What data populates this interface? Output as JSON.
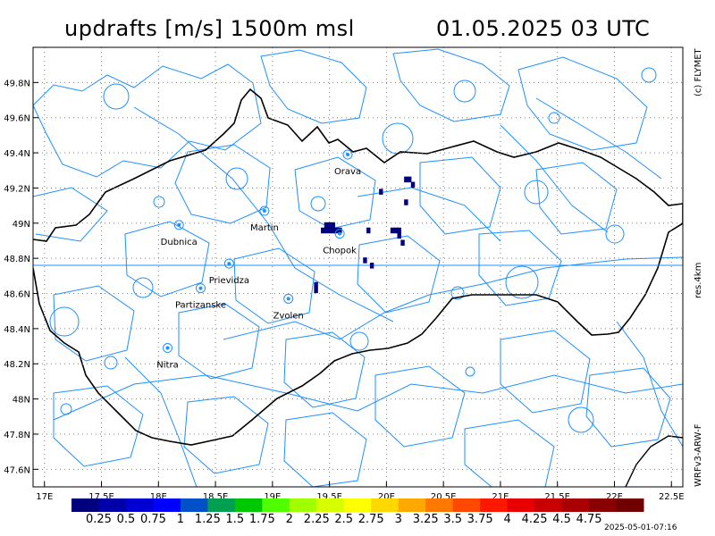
{
  "header": {
    "title_left": "updrafts [m/s] 1500m msl",
    "title_right": "01.05.2025   03 UTC"
  },
  "side_labels": {
    "copyright": "(c) FLYMET",
    "resolution": "res.4km",
    "model": "WRFv3-ARW-F"
  },
  "footer": {
    "timestamp": "2025-05-01-07:16"
  },
  "map": {
    "lat_labels": [
      "49.8N",
      "49.6N",
      "49.4N",
      "49.2N",
      "49N",
      "48.8N",
      "48.6N",
      "48.4N",
      "48.2N",
      "48N",
      "47.8N",
      "47.6N"
    ],
    "lat_values": [
      49.8,
      49.6,
      49.4,
      49.2,
      49.0,
      48.8,
      48.6,
      48.4,
      48.2,
      48.0,
      47.8,
      47.6
    ],
    "lon_labels": [
      "17E",
      "17.5E",
      "18E",
      "18.5E",
      "19E",
      "19.5E",
      "20E",
      "20.5E",
      "21E",
      "21.5E",
      "22E",
      "22.5E"
    ],
    "lon_values": [
      17.0,
      17.5,
      18.0,
      18.5,
      19.0,
      19.5,
      20.0,
      20.5,
      21.0,
      21.5,
      22.0,
      22.5
    ],
    "lon_range": [
      16.9,
      22.6
    ],
    "lat_range": [
      47.5,
      50.0
    ],
    "cities": [
      {
        "name": "Orava",
        "lon": 19.66,
        "lat": 49.39
      },
      {
        "name": "Martin",
        "lon": 18.93,
        "lat": 49.07
      },
      {
        "name": "Dubnica",
        "lon": 18.18,
        "lat": 48.99
      },
      {
        "name": "Chopok",
        "lon": 19.59,
        "lat": 48.94
      },
      {
        "name": "Prievidza",
        "lon": 18.62,
        "lat": 48.77
      },
      {
        "name": "Partizanske",
        "lon": 18.37,
        "lat": 48.63
      },
      {
        "name": "Zvolen",
        "lon": 19.14,
        "lat": 48.57
      },
      {
        "name": "Nitra",
        "lon": 18.08,
        "lat": 48.29
      }
    ],
    "updraft_cells": [
      {
        "lon": 19.44,
        "lat": 48.96
      },
      {
        "lon": 19.47,
        "lat": 48.96
      },
      {
        "lon": 19.5,
        "lat": 48.96
      },
      {
        "lon": 19.53,
        "lat": 48.96
      },
      {
        "lon": 19.56,
        "lat": 48.96
      },
      {
        "lon": 19.59,
        "lat": 48.96
      },
      {
        "lon": 19.47,
        "lat": 48.99
      },
      {
        "lon": 19.5,
        "lat": 48.99
      },
      {
        "lon": 19.53,
        "lat": 48.99
      },
      {
        "lon": 19.84,
        "lat": 48.96
      },
      {
        "lon": 20.05,
        "lat": 48.96
      },
      {
        "lon": 20.08,
        "lat": 48.96
      },
      {
        "lon": 20.11,
        "lat": 48.96
      },
      {
        "lon": 20.11,
        "lat": 48.93
      },
      {
        "lon": 20.14,
        "lat": 48.89
      },
      {
        "lon": 19.81,
        "lat": 48.79
      },
      {
        "lon": 19.87,
        "lat": 48.76
      },
      {
        "lon": 19.38,
        "lat": 48.65
      },
      {
        "lon": 19.38,
        "lat": 48.62
      },
      {
        "lon": 19.95,
        "lat": 49.18
      },
      {
        "lon": 20.17,
        "lat": 49.25
      },
      {
        "lon": 20.2,
        "lat": 49.25
      },
      {
        "lon": 20.23,
        "lat": 49.22
      },
      {
        "lon": 20.17,
        "lat": 49.12
      }
    ],
    "updraft_color": "#00007e"
  },
  "colorbar": {
    "labels": [
      "0.25",
      "0.5",
      "0.75",
      "1",
      "1.25",
      "1.5",
      "1.75",
      "2",
      "2.25",
      "2.5",
      "2.75",
      "3",
      "3.25",
      "3.5",
      "3.75",
      "4",
      "4.25",
      "4.5",
      "4.75"
    ],
    "colors": [
      "#00007e",
      "#0000a8",
      "#0000d4",
      "#0000ff",
      "#0050c8",
      "#00a050",
      "#00c800",
      "#50ff00",
      "#a0ff00",
      "#d8ff00",
      "#ffff00",
      "#ffd800",
      "#ffa800",
      "#ff7800",
      "#ff4800",
      "#ff1800",
      "#e80000",
      "#c80000",
      "#a80000",
      "#880000",
      "#700000"
    ]
  },
  "colors": {
    "terrain": "#1e90ff",
    "border": "#000000",
    "grid": "#7f7f7f"
  }
}
